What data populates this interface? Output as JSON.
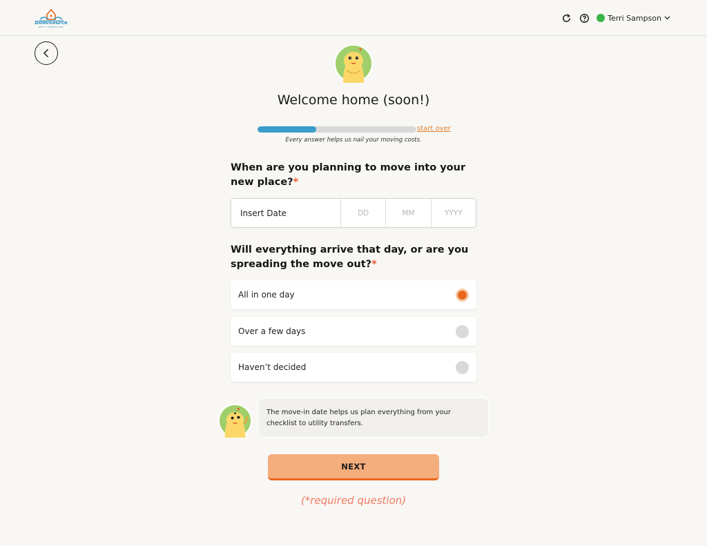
{
  "header": {
    "logo_name": "DomiSource",
    "logo_tagline": "NEXT CONNECTING",
    "refresh_icon": "refresh-icon",
    "help_icon": "help-icon",
    "user": {
      "name": "Terri Sampson",
      "status_color": "#3bb54a"
    }
  },
  "main": {
    "title": "Welcome home (soon!)",
    "progress": {
      "fraction": 0.37,
      "start_over_label": "start over",
      "note": "Every answer helps us nail your moving costs."
    },
    "question1": {
      "text": "When are you planning to move into your new place?",
      "required_mark": "*"
    },
    "date_input": {
      "label": "Insert Date",
      "day_placeholder": "DD",
      "month_placeholder": "MM",
      "year_placeholder": "YYYY"
    },
    "question2": {
      "text": "Will everything arrive that day, or are you spreading the move out?",
      "required_mark": "*"
    },
    "options": [
      {
        "label": "All in one day",
        "selected": true
      },
      {
        "label": "Over a few days",
        "selected": false
      },
      {
        "label": "Haven’t decided",
        "selected": false
      }
    ],
    "tip": "The move-in date helps us plan everything from your checklist to utility transfers.",
    "next_label": "NEXT",
    "required_note": "(*required question)"
  },
  "colors": {
    "accent": "#e8661d",
    "progress": "#3a9ccc",
    "button": "#f4ad7c",
    "required": "#f07a62"
  }
}
